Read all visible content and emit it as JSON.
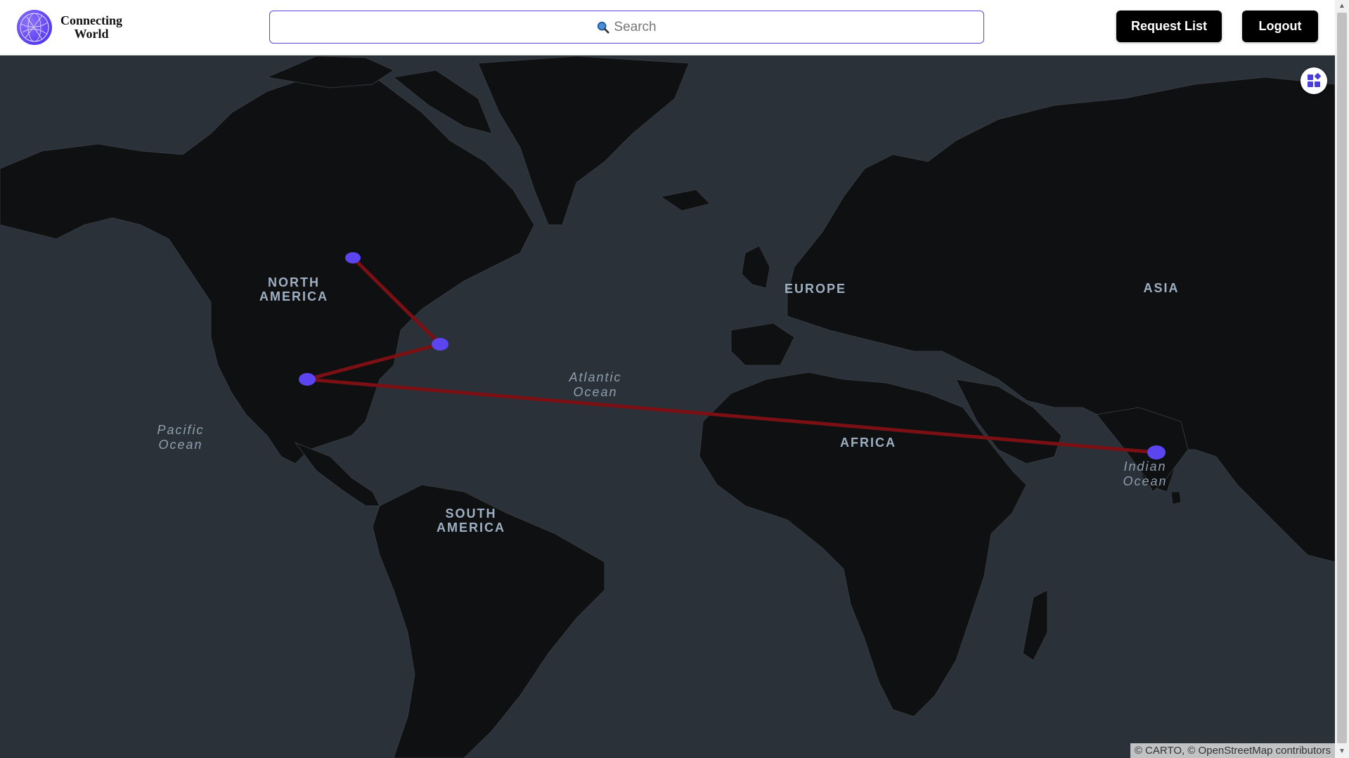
{
  "header": {
    "brand_line1": "Connecting",
    "brand_line2": "World",
    "search_placeholder": "Search",
    "request_list_label": "Request List",
    "logout_label": "Logout"
  },
  "map": {
    "continents": {
      "north_america": [
        "NORTH",
        "AMERICA"
      ],
      "south_america": [
        "SOUTH",
        "AMERICA"
      ],
      "europe": "EUROPE",
      "africa": "AFRICA",
      "asia": "ASIA"
    },
    "oceans": {
      "atlantic": [
        "Atlantic",
        "Ocean"
      ],
      "pacific": [
        "Pacific",
        "Ocean"
      ],
      "indian": [
        "Indian",
        "Ocean"
      ]
    },
    "attribution": "© CARTO, © OpenStreetMap contributors",
    "marker_color": "#5b45f0",
    "route_color": "#7a0f14",
    "land_color": "#0f1012",
    "water_color": "#2b3138"
  },
  "icons": {
    "layers": "layers-icon",
    "search": "search-icon",
    "logo": "globe-logo-icon"
  }
}
